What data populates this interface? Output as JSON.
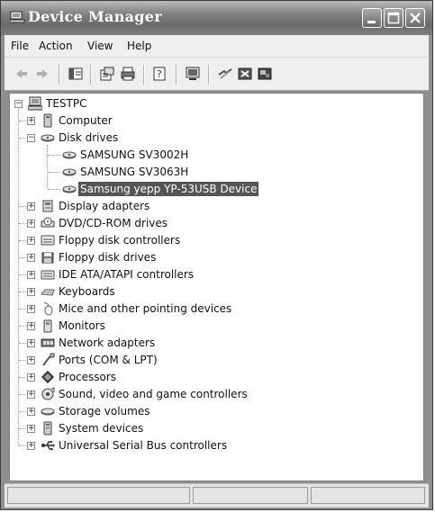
{
  "window": {
    "title": "Device Manager"
  },
  "menu": {
    "items": [
      "File",
      "Action",
      "View",
      "Help"
    ]
  },
  "toolbar": {
    "icons": [
      "back-arrow-icon",
      "forward-arrow-icon",
      "show-hide-console-tree-icon",
      "properties-icon",
      "print-icon",
      "help-icon",
      "scan-hardware-icon",
      "uninstall-icon",
      "disable-device-icon",
      "update-driver-icon"
    ]
  },
  "tree": {
    "root": "TESTPC",
    "categories": [
      {
        "label": "Computer",
        "expanded": false,
        "icon": "computer-icon"
      },
      {
        "label": "Disk drives",
        "expanded": true,
        "icon": "disk-drive-icon",
        "children": [
          {
            "label": "SAMSUNG SV3002H",
            "icon": "disk-drive-icon"
          },
          {
            "label": "SAMSUNG SV3063H",
            "icon": "disk-drive-icon"
          },
          {
            "label": "Samsung yepp YP-53USB Device",
            "icon": "disk-drive-icon",
            "selected": true
          }
        ]
      },
      {
        "label": "Display adapters",
        "expanded": false,
        "icon": "display-adapter-icon"
      },
      {
        "label": "DVD/CD-ROM drives",
        "expanded": false,
        "icon": "cdrom-icon"
      },
      {
        "label": "Floppy disk controllers",
        "expanded": false,
        "icon": "floppy-controller-icon"
      },
      {
        "label": "Floppy disk drives",
        "expanded": false,
        "icon": "floppy-drive-icon"
      },
      {
        "label": "IDE ATA/ATAPI controllers",
        "expanded": false,
        "icon": "ide-controller-icon"
      },
      {
        "label": "Keyboards",
        "expanded": false,
        "icon": "keyboard-icon"
      },
      {
        "label": "Mice and other pointing devices",
        "expanded": false,
        "icon": "mouse-icon"
      },
      {
        "label": "Monitors",
        "expanded": false,
        "icon": "monitor-icon"
      },
      {
        "label": "Network adapters",
        "expanded": false,
        "icon": "network-adapter-icon"
      },
      {
        "label": "Ports (COM & LPT)",
        "expanded": false,
        "icon": "port-icon"
      },
      {
        "label": "Processors",
        "expanded": false,
        "icon": "processor-icon"
      },
      {
        "label": "Sound, video and game controllers",
        "expanded": false,
        "icon": "sound-icon"
      },
      {
        "label": "Storage volumes",
        "expanded": false,
        "icon": "storage-volume-icon"
      },
      {
        "label": "System devices",
        "expanded": false,
        "icon": "system-device-icon"
      },
      {
        "label": "Universal Serial Bus controllers",
        "expanded": false,
        "icon": "usb-icon"
      }
    ]
  },
  "status": {
    "panes": [
      "",
      "",
      ""
    ]
  }
}
